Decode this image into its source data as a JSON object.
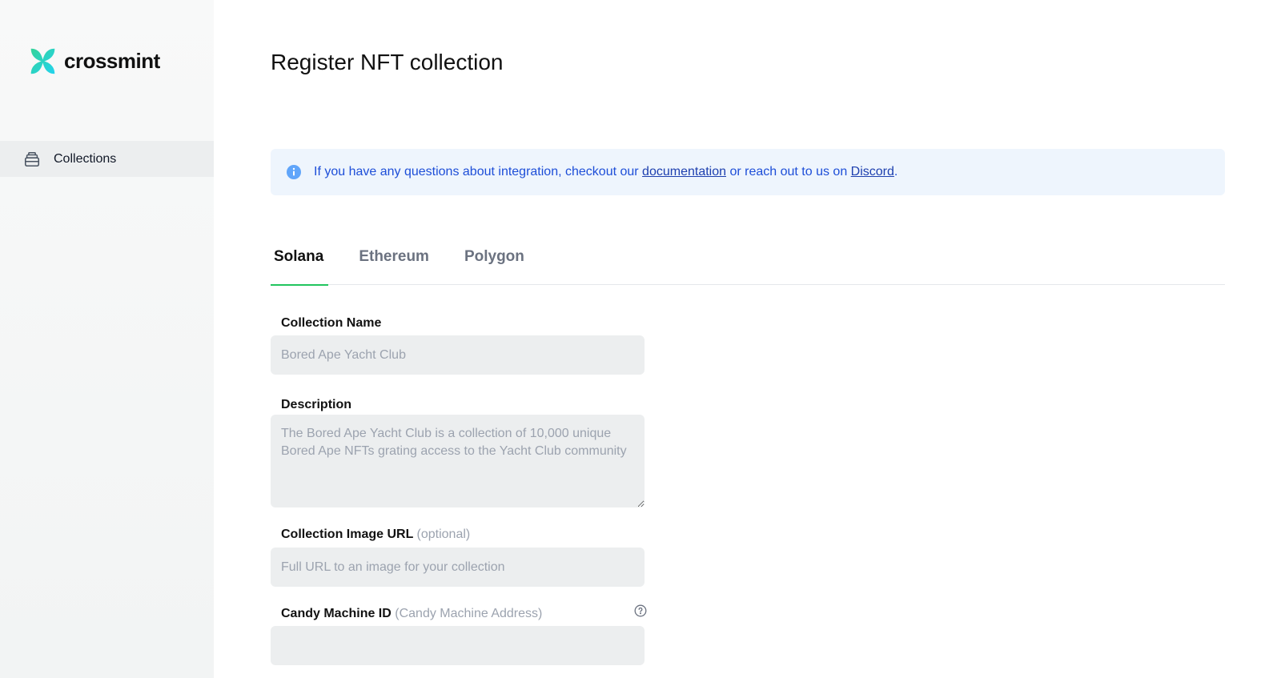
{
  "brand": {
    "name": "crossmint",
    "accent": "#22c55e"
  },
  "sidebar": {
    "items": [
      {
        "label": "Collections",
        "icon": "collection-stack-icon",
        "active": true
      }
    ]
  },
  "main": {
    "title": "Register NFT collection",
    "alert": {
      "icon": "info-icon",
      "prefix": "If you have any questions about integration, checkout our ",
      "link1": "documentation",
      "middle": " or reach out to us on ",
      "link2": "Discord",
      "suffix": "."
    },
    "tabs": [
      {
        "label": "Solana",
        "active": true
      },
      {
        "label": "Ethereum",
        "active": false
      },
      {
        "label": "Polygon",
        "active": false
      }
    ],
    "form": {
      "collection_name": {
        "label": "Collection Name",
        "placeholder": "Bored Ape Yacht Club",
        "value": ""
      },
      "description": {
        "label": "Description",
        "placeholder": "The Bored Ape Yacht Club is a collection of 10,000 unique Bored Ape NFTs grating access to the Yacht Club community",
        "value": ""
      },
      "image_url": {
        "label": "Collection Image URL",
        "hint": "(optional)",
        "placeholder": "Full URL to an image for your collection",
        "value": ""
      },
      "candy_machine": {
        "label": "Candy Machine ID",
        "hint": "(Candy Machine Address)",
        "placeholder": "",
        "value": "",
        "help_icon": "question-circle-icon"
      }
    }
  }
}
